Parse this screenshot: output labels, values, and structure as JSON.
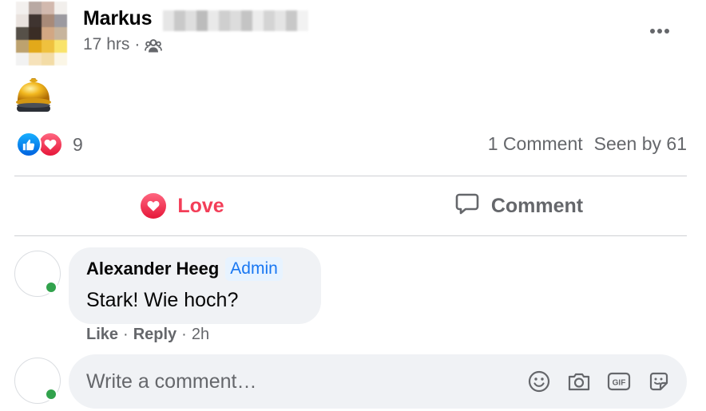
{
  "post": {
    "author_name": "Markus",
    "time": "17 hrs",
    "separator": "·",
    "audience_icon": "friends-icon",
    "more_icon": "more-dots-icon",
    "content_emoji": "bell-icon"
  },
  "reactions": {
    "types": [
      "like",
      "love"
    ],
    "count": "9",
    "comments": "1 Comment",
    "seen": "Seen by 61"
  },
  "actions": {
    "love": "Love",
    "comment": "Comment"
  },
  "comment": {
    "author": "Alexander Heeg",
    "badge": "Admin",
    "text": "Stark! Wie hoch?",
    "like": "Like",
    "reply": "Reply",
    "separator": "·",
    "time": "2h"
  },
  "composer": {
    "placeholder": "Write a comment…",
    "tools": [
      "emoji-icon",
      "camera-icon",
      "gif-icon",
      "sticker-icon"
    ]
  },
  "colors": {
    "accent": "#1877f2",
    "love": "#f33e58",
    "secondary_text": "#65676b",
    "bubble": "#f0f2f5",
    "online": "#31a24c"
  }
}
